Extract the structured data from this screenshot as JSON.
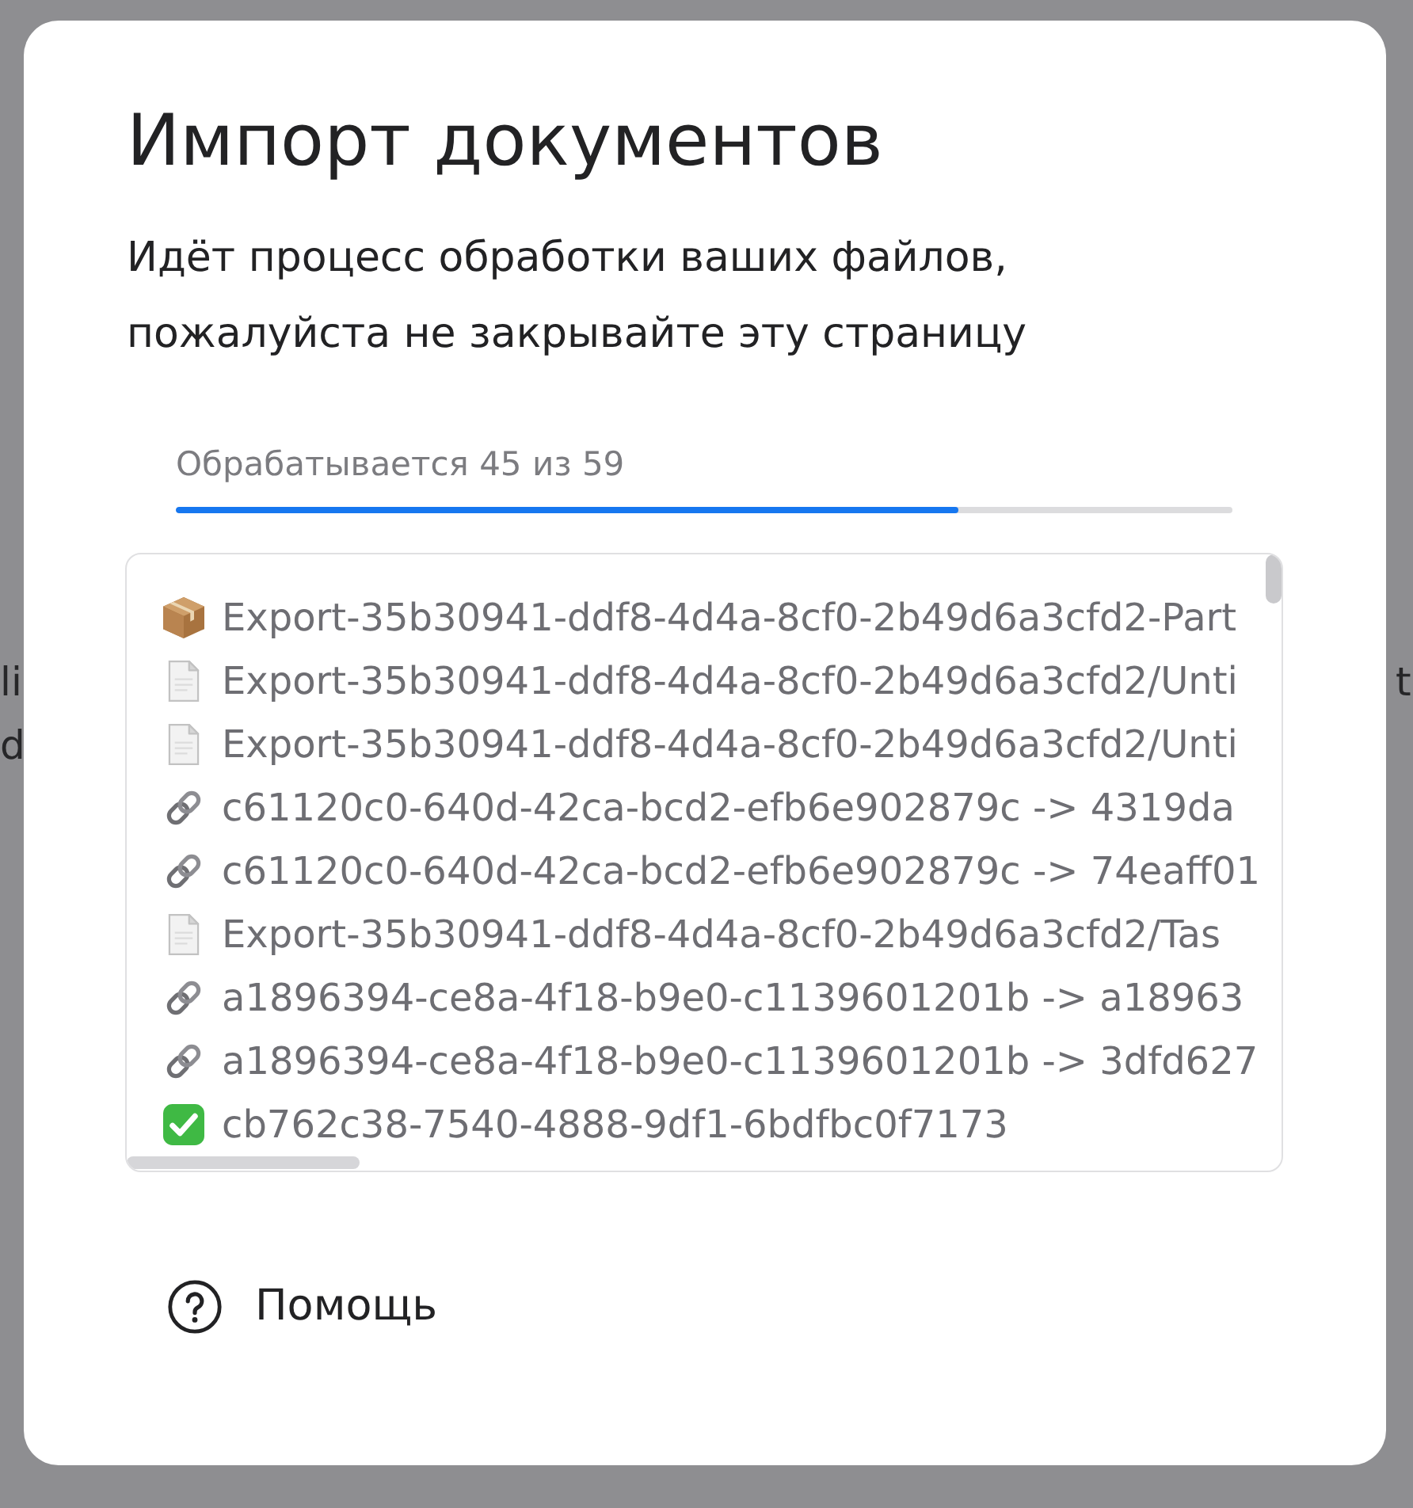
{
  "backdrop": {
    "left_fragments": [
      "li",
      "d"
    ],
    "right_fragments": [
      "t"
    ]
  },
  "dialog": {
    "title": "Импорт документов",
    "message": "Идёт процесс обработки ваших файлов, пожалуйста не закрывайте эту страницу",
    "progress": {
      "label": "Обрабатывается 45 из 59",
      "level": 0.74
    },
    "log": {
      "entries": [
        {
          "kind": "package",
          "text": "Export-35b30941-ddf8-4d4a-8cf0-2b49d6a3cfd2-Part"
        },
        {
          "kind": "file",
          "text": "Export-35b30941-ddf8-4d4a-8cf0-2b49d6a3cfd2/Unti"
        },
        {
          "kind": "file",
          "text": "Export-35b30941-ddf8-4d4a-8cf0-2b49d6a3cfd2/Unti"
        },
        {
          "kind": "link",
          "text": "c61120c0-640d-42ca-bcd2-efb6e902879c -> 4319da"
        },
        {
          "kind": "link",
          "text": "c61120c0-640d-42ca-bcd2-efb6e902879c -> 74eaff01"
        },
        {
          "kind": "file",
          "text": "Export-35b30941-ddf8-4d4a-8cf0-2b49d6a3cfd2/Tas"
        },
        {
          "kind": "link",
          "text": "a1896394-ce8a-4f18-b9e0-c1139601201b -> a18963"
        },
        {
          "kind": "link",
          "text": "a1896394-ce8a-4f18-b9e0-c1139601201b -> 3dfd627"
        },
        {
          "kind": "done",
          "text": "cb762c38-7540-4888-9df1-6bdfbc0f7173"
        }
      ]
    },
    "help": {
      "label": "Помощь"
    }
  }
}
